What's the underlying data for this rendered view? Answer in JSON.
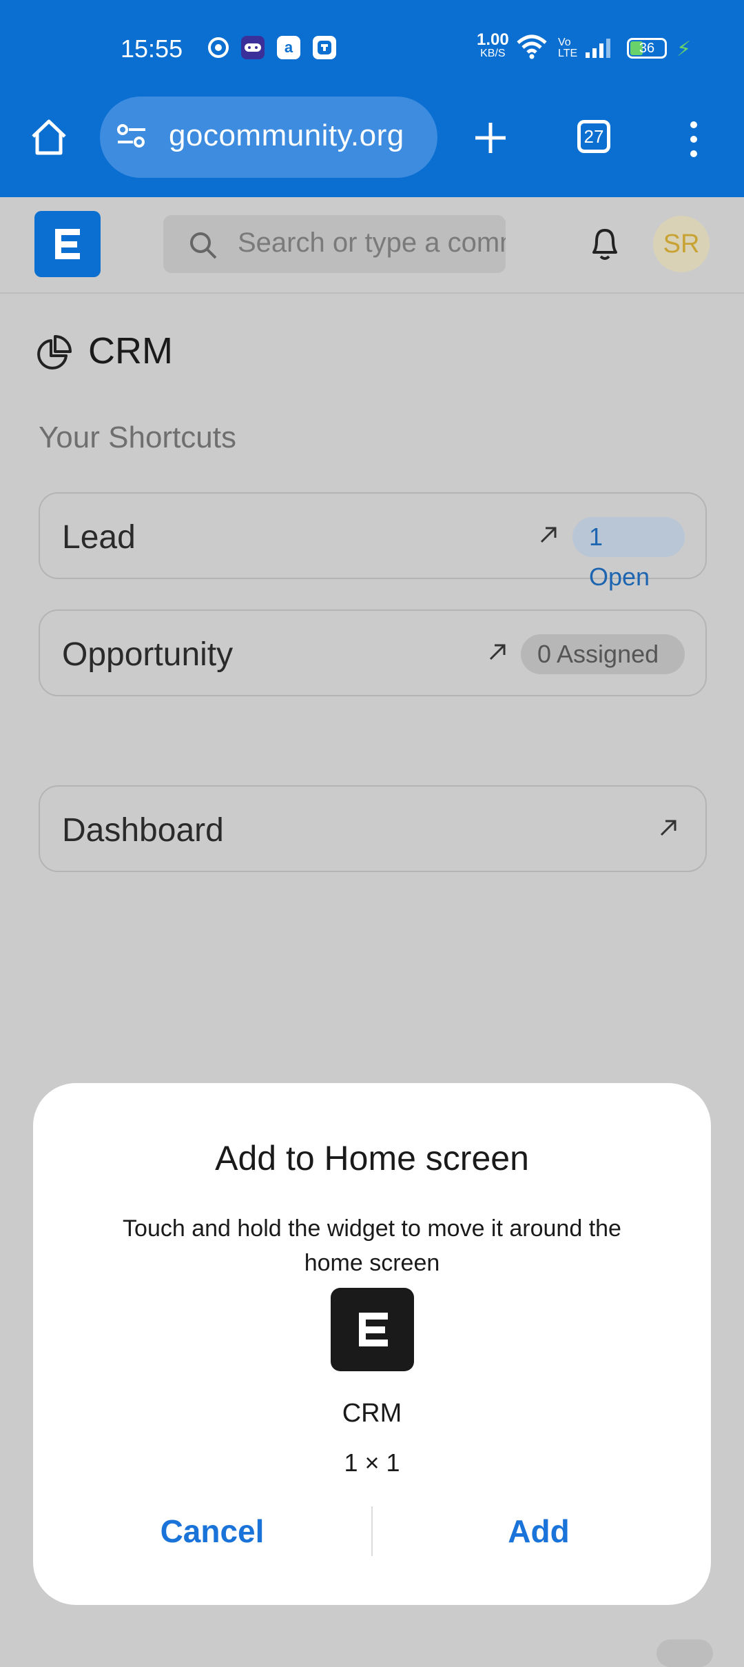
{
  "status_bar": {
    "time": "15:55",
    "network_speed_value": "1.00",
    "network_speed_unit": "KB/S",
    "volte_top": "Vo",
    "volte_bottom": "LTE",
    "battery_level": "36",
    "icons": [
      "chrome-icon",
      "game-icon",
      "amazon-icon",
      "app-icon",
      "wifi-icon",
      "signal-icon",
      "battery-icon",
      "charging-icon"
    ]
  },
  "browser": {
    "url": "gocommunity.org",
    "tab_count": "27",
    "accent_color": "#0a6fd0"
  },
  "app_header": {
    "search_placeholder": "Search or type a command",
    "avatar_initials": "SR"
  },
  "page": {
    "title": "CRM",
    "section_label": "Your Shortcuts",
    "shortcuts": [
      {
        "label": "Lead",
        "badge": "1 Open"
      },
      {
        "label": "Opportunity",
        "badge": "0 Assigned"
      },
      {
        "label": "Dashboard",
        "badge": ""
      }
    ]
  },
  "dialog": {
    "title": "Add to Home screen",
    "message": "Touch and hold the widget to move it around the home screen",
    "app_name": "CRM",
    "widget_size": "1 × 1",
    "cancel_label": "Cancel",
    "add_label": "Add",
    "button_color": "#1a73d9"
  }
}
